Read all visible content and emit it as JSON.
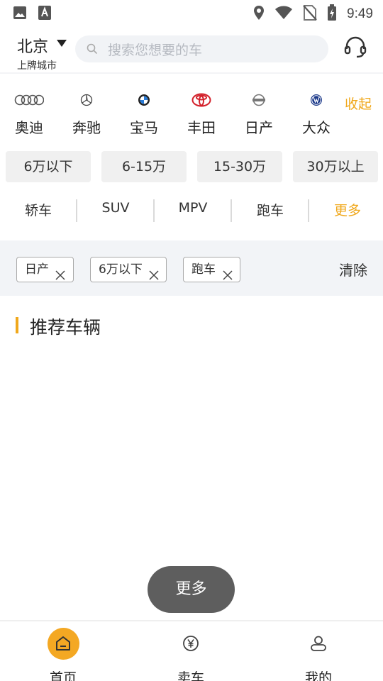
{
  "status_bar": {
    "time": "9:49",
    "icons": [
      "image-icon",
      "font-icon",
      "location-icon",
      "wifi-icon",
      "no-sim-icon",
      "battery-charging-icon"
    ]
  },
  "header": {
    "city": "北京",
    "city_sub": "上牌城市",
    "search_placeholder": "搜索您想要的车",
    "service_icon": "headset-icon"
  },
  "brands": {
    "items": [
      {
        "label": "奥迪",
        "icon": "audi-logo-icon"
      },
      {
        "label": "奔驰",
        "icon": "mercedes-logo-icon"
      },
      {
        "label": "宝马",
        "icon": "bmw-logo-icon"
      },
      {
        "label": "丰田",
        "icon": "toyota-logo-icon"
      },
      {
        "label": "日产",
        "icon": "nissan-logo-icon"
      },
      {
        "label": "大众",
        "icon": "volkswagen-logo-icon"
      }
    ],
    "collapse_label": "收起"
  },
  "price_filters": [
    "6万以下",
    "6-15万",
    "15-30万",
    "30万以上"
  ],
  "type_filters": {
    "items": [
      "轿车",
      "SUV",
      "MPV",
      "跑车"
    ],
    "more_label": "更多"
  },
  "selected_tags": {
    "items": [
      "日产",
      "6万以下",
      "跑车"
    ],
    "clear_label": "清除"
  },
  "recommend": {
    "title": "推荐车辆"
  },
  "float_button": {
    "label": "更多"
  },
  "bottom_nav": {
    "items": [
      {
        "label": "首页",
        "icon": "home-icon",
        "active": true
      },
      {
        "label": "卖车",
        "icon": "yen-icon",
        "active": false
      },
      {
        "label": "我的",
        "icon": "profile-icon",
        "active": false
      }
    ]
  },
  "colors": {
    "accent": "#f0a81c",
    "tag_bar_bg": "#f2f4f7",
    "float_button_bg": "#5e5e5e"
  }
}
